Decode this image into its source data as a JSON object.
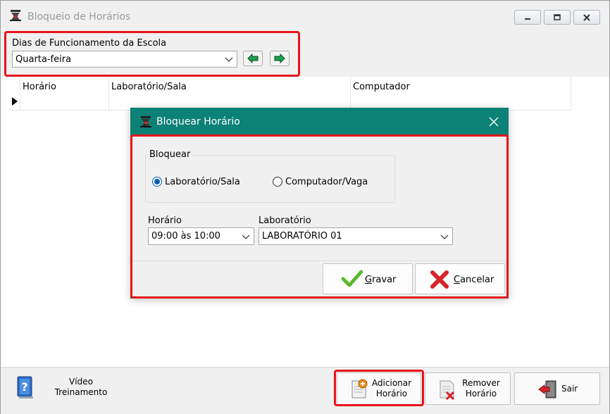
{
  "window": {
    "title": "Bloqueio de Horários"
  },
  "top_panel": {
    "label": "Dias de Funcionamento da Escola",
    "selected_day": "Quarta-feira"
  },
  "grid": {
    "columns": [
      "Horário",
      "Laboratório/Sala",
      "Computador"
    ]
  },
  "dialog": {
    "title": "Bloquear Horário",
    "group_label": "Bloquear",
    "radio_options": [
      {
        "label": "Laboratório/Sala",
        "checked": true
      },
      {
        "label": "Computador/Vaga",
        "checked": false
      }
    ],
    "horario_label": "Horário",
    "horario_value": "09:00 às 10:00",
    "laboratorio_label": "Laboratório",
    "laboratorio_value": "LABORATÓRIO 01",
    "save_label_first": "G",
    "save_label_rest": "ravar",
    "cancel_label_first": "C",
    "cancel_label_rest": "ancelar"
  },
  "toolbar": {
    "video_line1": "Vídeo",
    "video_line2": "Treinamento",
    "add_line1": "Adicionar",
    "add_line2": "Horário",
    "remove_line1": "Remover",
    "remove_line2": "Horário",
    "exit_label": "Sair"
  },
  "colors": {
    "dialog_title_bg": "#0c8176",
    "highlight_border": "#e8141b"
  }
}
